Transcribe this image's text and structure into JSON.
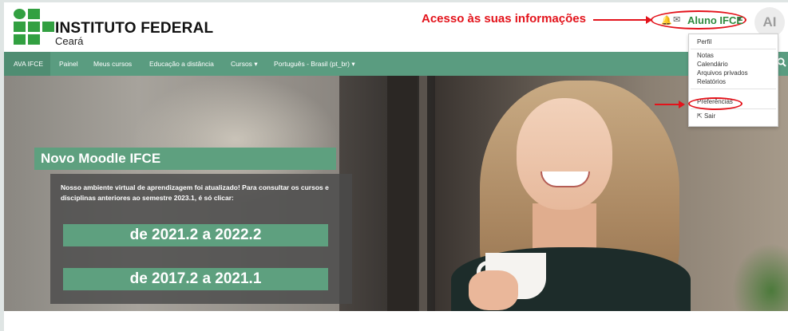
{
  "brand": {
    "title": "INSTITUTO FEDERAL",
    "subtitle": "Ceará",
    "logo_color": "#32a041"
  },
  "annotation": {
    "text": "Acesso às suas informações",
    "color": "#e3131b"
  },
  "user_menu": {
    "name": "Aluno IFCE",
    "avatar_initials": "AI",
    "items": [
      "Perfil",
      "Notas",
      "Calendário",
      "Arquivos privados",
      "Relatórios",
      "Preferências",
      "Sair"
    ]
  },
  "nav": {
    "items": [
      "AVA IFCE",
      "Painel",
      "Meus cursos",
      "Educação a distância",
      "Cursos",
      "Português - Brasil (pt_br)"
    ],
    "active_index": 0,
    "bar_color": "#5a9c80"
  },
  "hero": {
    "headline": "Novo Moodle IFCE",
    "description": "Nosso ambiente virtual de aprendizagem foi atualizado! Para consultar os cursos e disciplinas anteriores ao semestre 2023.1, é só clicar:",
    "buttons": [
      "de 2021.2 a 2022.2",
      "de 2017.2 a 2021.1"
    ],
    "accent": "#5ea07f"
  }
}
